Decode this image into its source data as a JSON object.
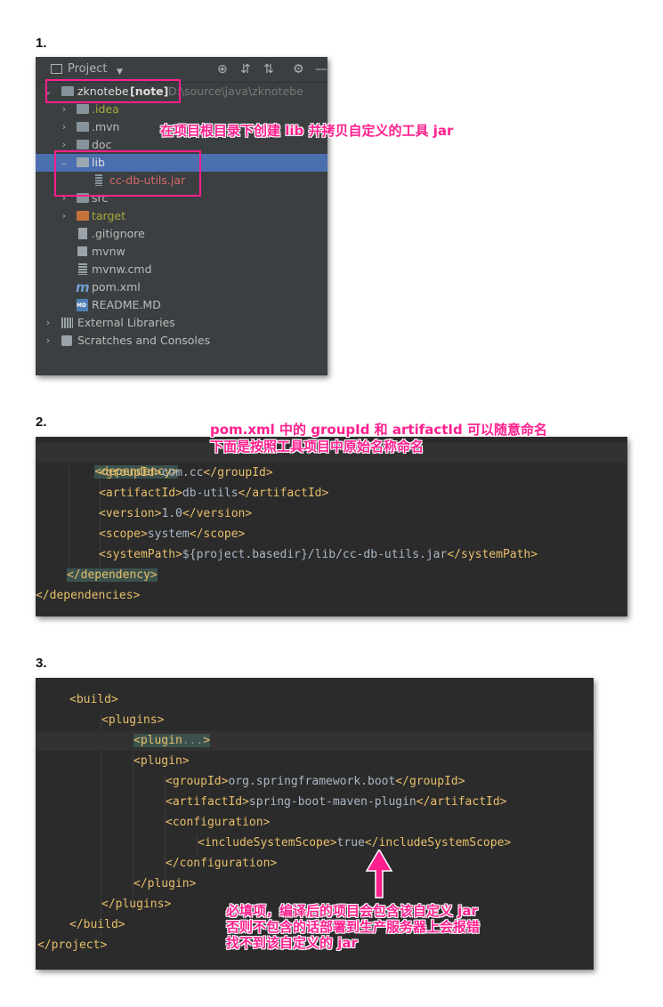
{
  "steps": {
    "one": "1.",
    "two": "2.",
    "three": "3."
  },
  "tree": {
    "toolbar": {
      "title": "Project",
      "dropdown": "▼",
      "locate": "⊕",
      "expand": "⇵",
      "collapse": "⇅",
      "settings": "⚙",
      "hide": "—"
    },
    "root": {
      "name": "zknotebe",
      "tag": "[note]",
      "path": "D:\\source\\java\\zknotebe"
    },
    "items": [
      {
        "label": "idea",
        "prefix": "."
      },
      {
        "label": ".mvn"
      },
      {
        "label": "doc"
      },
      {
        "label": "lib"
      },
      {
        "label": "cc-db-utils.jar"
      },
      {
        "label": "src"
      },
      {
        "label": "target"
      },
      {
        "label": ".gitignore"
      },
      {
        "label": "mvnw"
      },
      {
        "label": "mvnw.cmd"
      },
      {
        "label": "pom.xml"
      },
      {
        "label": "README.MD"
      },
      {
        "label": "External Libraries"
      },
      {
        "label": "Scratches and Consoles"
      }
    ],
    "icons": {
      "md_badge": "MD",
      "maven": "m"
    },
    "annotation": "在项目根目录下创建 lib 并拷贝自定义的工具 jar"
  },
  "code1": {
    "annotation_line1": "pom.xml 中的 groupId 和 artifactId 可以随意命名",
    "annotation_line2": "下面是按照工具项目中原始名称命名",
    "lines": [
      {
        "tag_open": "<dependency>"
      },
      {
        "tag_open": "<groupId>",
        "text": "com.cc",
        "tag_close": "</groupId>"
      },
      {
        "tag_open": "<artifactId>",
        "text": "db-utils",
        "tag_close": "</artifactId>"
      },
      {
        "tag_open": "<version>",
        "text": "1.0",
        "tag_close": "</version>"
      },
      {
        "tag_open": "<scope>",
        "text": "system",
        "tag_close": "</scope>"
      },
      {
        "tag_open": "<systemPath>",
        "text": "${project.basedir}/lib/cc-db-utils.jar",
        "tag_close": "</systemPath>"
      },
      {
        "tag_open": "</dependency>"
      },
      {
        "tag_open": "</dependencies>"
      }
    ]
  },
  "code2": {
    "lines": [
      {
        "tag_open": "<build>"
      },
      {
        "tag_open": "<plugins>"
      },
      {
        "tag_open": "<plugin",
        "text": "...",
        "tag_close": ">"
      },
      {
        "tag_open": "<plugin>"
      },
      {
        "tag_open": "<groupId>",
        "text": "org.springframework.boot",
        "tag_close": "</groupId>"
      },
      {
        "tag_open": "<artifactId>",
        "text": "spring-boot-maven-plugin",
        "tag_close": "</artifactId>"
      },
      {
        "tag_open": "<configuration>"
      },
      {
        "tag_open": "<includeSystemScope>",
        "text": "true",
        "tag_close": "</includeSystemScope>"
      },
      {
        "tag_open": "</configuration>"
      },
      {
        "tag_open": "</plugin>"
      },
      {
        "tag_open": "</plugins>"
      },
      {
        "tag_open": "</build>"
      },
      {
        "tag_open": "</project>"
      }
    ],
    "annotation_line1": "必填项，编译后的项目会包含该自定义 jar",
    "annotation_line2": "否则不包含的话部署到生产服务器上会报错",
    "annotation_line3": "找不到该自定义的 jar"
  },
  "colors": {
    "accent": "#ff1f8e",
    "tag": "#e8bf6a",
    "code_text": "#a9b7c6",
    "selection": "#4b6eaf",
    "editor_bg": "#2b2b2b",
    "tree_bg": "#3c3f41"
  }
}
